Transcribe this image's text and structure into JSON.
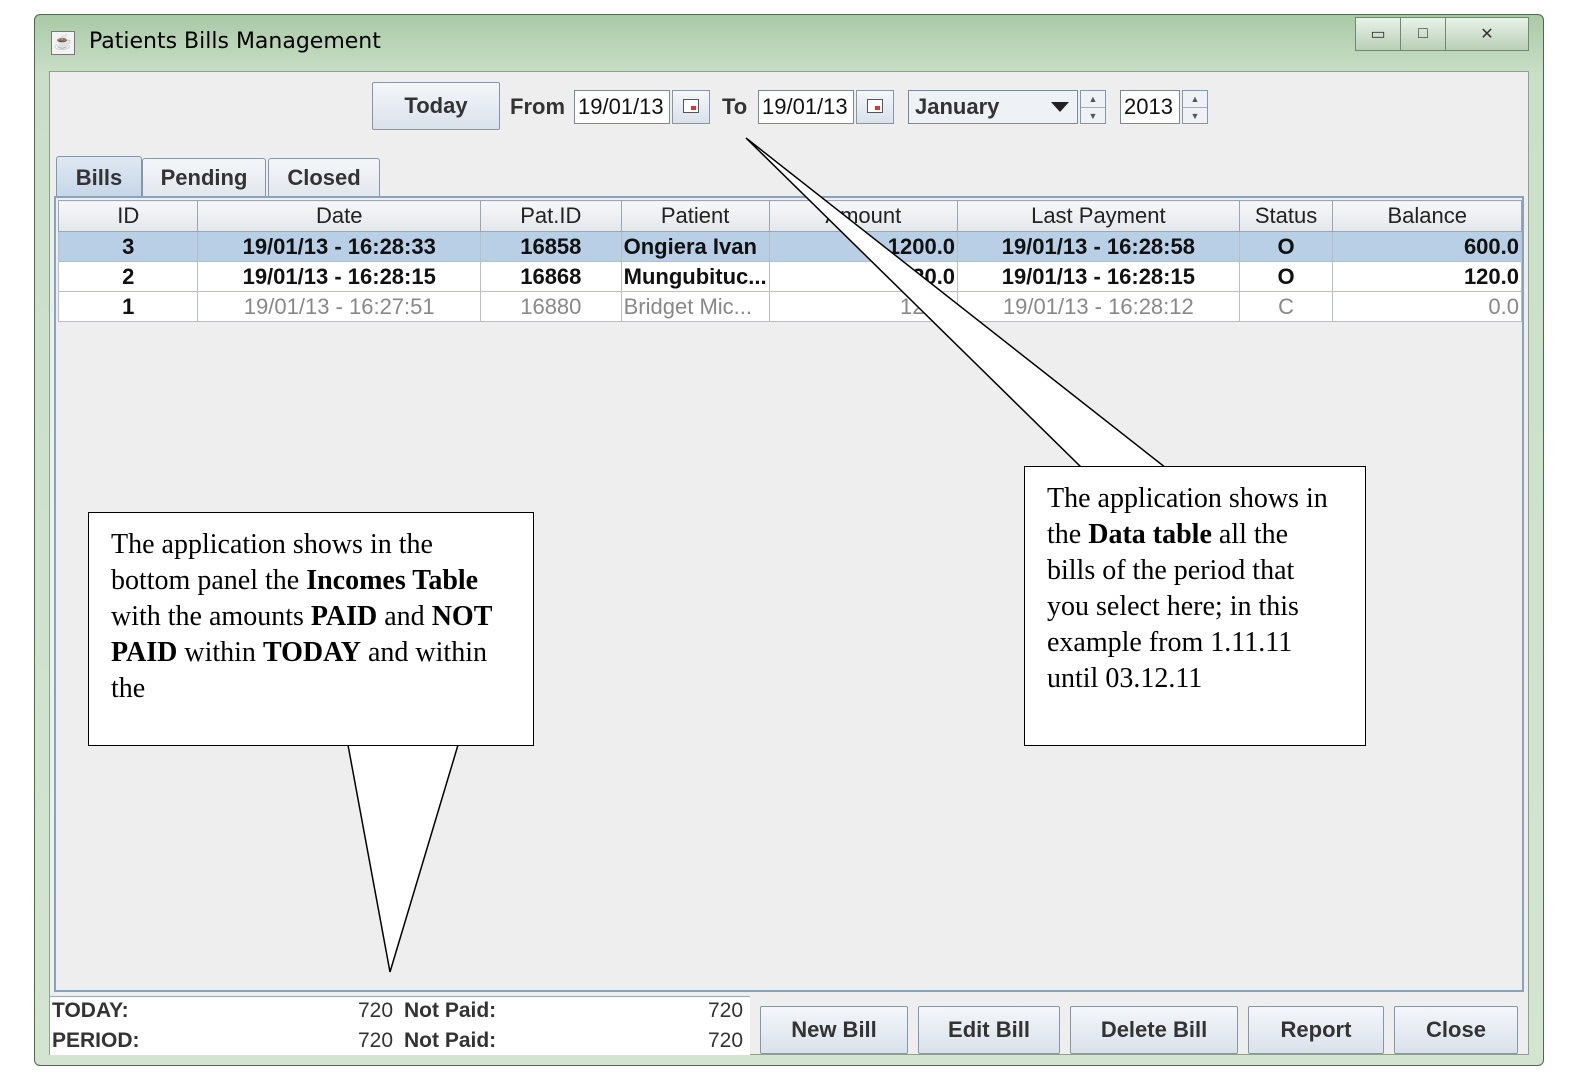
{
  "window": {
    "title": "Patients Bills Management"
  },
  "toolbar": {
    "today_label": "Today",
    "from_label": "From",
    "from_value": "19/01/13",
    "to_label": "To",
    "to_value": "19/01/13",
    "month_value": "January",
    "year_value": "2013"
  },
  "tabs": [
    {
      "label": "Bills",
      "active": true
    },
    {
      "label": "Pending",
      "active": false
    },
    {
      "label": "Closed",
      "active": false
    }
  ],
  "table": {
    "columns": [
      "ID",
      "Date",
      "Pat.ID",
      "Patient",
      "Amount",
      "Last Payment",
      "Status",
      "Balance"
    ],
    "rows": [
      {
        "id": "3",
        "date": "19/01/13 - 16:28:33",
        "patid": "16858",
        "patient": "Ongiera Ivan",
        "amount": "1200.0",
        "last_payment": "19/01/13 - 16:28:58",
        "status": "O",
        "balance": "600.0",
        "style": "selected"
      },
      {
        "id": "2",
        "date": "19/01/13 - 16:28:15",
        "patid": "16868",
        "patient": "Mungubituc...",
        "amount": "120.0",
        "last_payment": "19/01/13 - 16:28:15",
        "status": "O",
        "balance": "120.0",
        "style": "open"
      },
      {
        "id": "1",
        "date": "19/01/13 - 16:27:51",
        "patid": "16880",
        "patient": "Bridget Mic...",
        "amount": "120.0",
        "last_payment": "19/01/13 - 16:28:12",
        "status": "C",
        "balance": "0.0",
        "style": "closed"
      }
    ]
  },
  "totals": {
    "today_label": "TODAY:",
    "today_amount": "720",
    "today_notpaid_label": "Not Paid:",
    "today_notpaid": "720",
    "period_label": "PERIOD:",
    "period_amount": "720",
    "period_notpaid_label": "Not Paid:",
    "period_notpaid": "720"
  },
  "buttons": {
    "new_bill": "New Bill",
    "edit_bill": "Edit Bill",
    "delete_bill": "Delete Bill",
    "report": "Report",
    "close": "Close"
  },
  "callouts": {
    "left": {
      "t1": "The application shows in the bottom panel the ",
      "b1": "Incomes Table",
      "t2": " with the amounts ",
      "b2": "PAID",
      "t3": " and ",
      "b3": "NOT PAID",
      "t4": " within ",
      "b4": "TODAY",
      "t5": " and within the"
    },
    "right": {
      "t1": "The application shows in the ",
      "b1": "Data table",
      "t2": " all the bills of the period that you select here; in this example from 1.11.11 until 03.12.11"
    }
  }
}
